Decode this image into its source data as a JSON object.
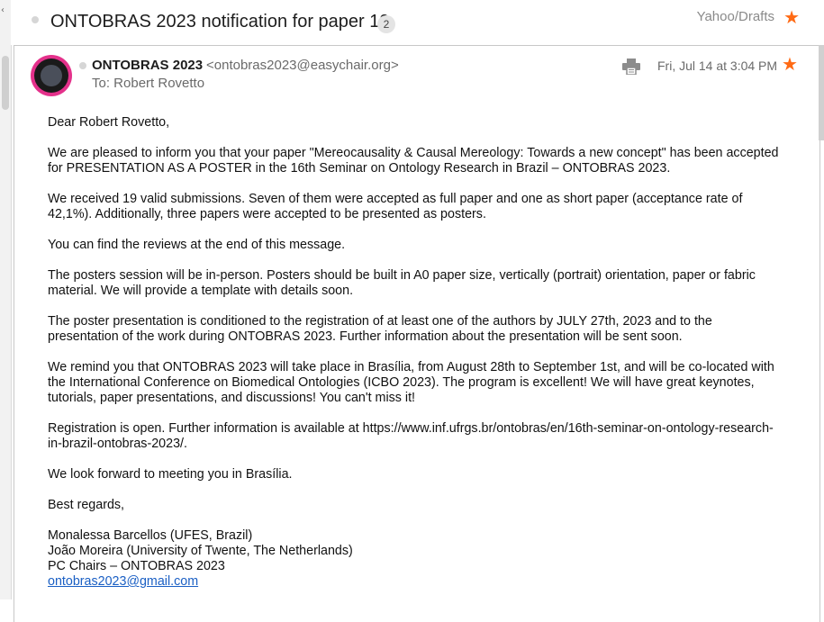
{
  "thread": {
    "subject": "ONTOBRAS 2023 notification for paper 19",
    "count": "2",
    "folder": "Yahoo/Drafts"
  },
  "message": {
    "from_name": "ONTOBRAS 2023",
    "from_email": "<ontobras2023@easychair.org>",
    "to": "To: Robert Rovetto",
    "date": "Fri, Jul 14 at 3:04 PM",
    "body": {
      "greeting": "Dear Robert Rovetto,",
      "p1": "We are pleased to inform you that your paper \"Mereocausality & Causal Mereology: Towards a new concept\" has been accepted for PRESENTATION AS A  POSTER  in the 16th Seminar on Ontology Research in Brazil  – ONTOBRAS 2023.",
      "p2": "We received 19 valid submissions. Seven of them were accepted as full paper and one as short paper (acceptance rate of 42,1%). Additionally, three papers were accepted to be presented as posters.",
      "p3": "You can find the reviews at the end of this message.",
      "p4": "The posters session will be in-person. Posters should be built in A0 paper size, vertically (portrait) orientation, paper or fabric material. We will provide a template with details soon.",
      "p5": "The poster presentation is conditioned to the registration of at least one of the authors by JULY 27th, 2023 and to the presentation of the work during ONTOBRAS 2023. Further information about the presentation will be sent soon.",
      "p6": "We remind you that ONTOBRAS 2023 will take place in Brasília, from August 28th to September 1st, and will be co-located with the International Conference on Biomedical Ontologies (ICBO 2023). The program is excellent! We will have great keynotes, tutorials, paper presentations, and discussions! You can't miss it!",
      "p7": "Registration is open.  Further information is available at https://www.inf.ufrgs.br/ontobras/en/16th-seminar-on-ontology-research-in-brazil-ontobras-2023/.",
      "p8": "We look forward to meeting you in Brasília.",
      "closing": "Best regards,",
      "sig1": "Monalessa  Barcellos (UFES, Brazil)",
      "sig2": "João Moreira (University of Twente, The Netherlands)",
      "sig3": "PC Chairs – ONTOBRAS 2023",
      "sig_email": "ontobras2023@gmail.com"
    }
  },
  "icons": {
    "star": "★",
    "star_color": "#ff6a14",
    "print": "print-icon",
    "back": "‹"
  }
}
